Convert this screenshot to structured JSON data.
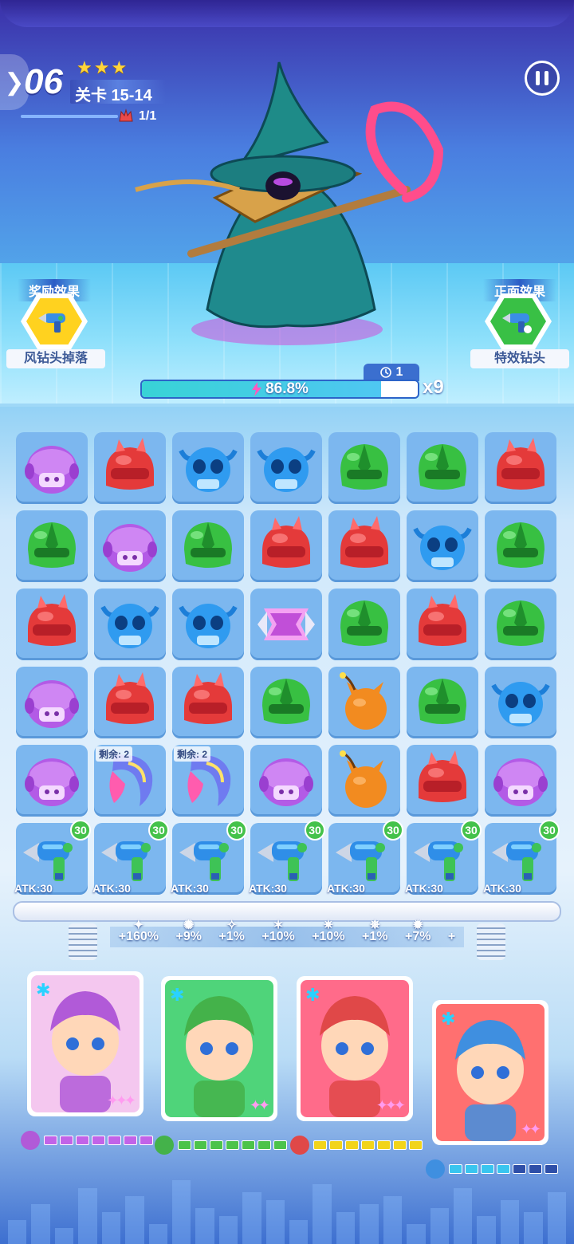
{
  "header": {
    "wave_number": "06",
    "stars": "★★★",
    "stage_label": "关卡 15-14",
    "kill_progress": "1/1",
    "kill_progress_fraction": 1.0,
    "pause_icon": "pause-icon"
  },
  "boss": {
    "name_icon": "witch-boss"
  },
  "reward_effect": {
    "title": "奖励效果",
    "caption": "风钻头掉落",
    "icon": "drill-gun-icon",
    "hex_color": "#ffd21f"
  },
  "positive_effect": {
    "title": "正面效果",
    "caption": "特效钻头",
    "icon": "drill-gun-icon",
    "hex_color": "#39c045"
  },
  "energy": {
    "timer": "1",
    "percent_text": "86.8%",
    "percent": 86.8,
    "multiplier": "x9"
  },
  "board": {
    "rows": [
      [
        "purple",
        "red",
        "blue",
        "blue",
        "green",
        "green",
        "red"
      ],
      [
        "green",
        "purple",
        "green",
        "red",
        "red",
        "blue",
        "green"
      ],
      [
        "red",
        "blue",
        "blue",
        "crystal",
        "green",
        "red",
        "green"
      ],
      [
        "purple",
        "red",
        "red",
        "green",
        "bomb",
        "green",
        "blue"
      ],
      [
        "purple",
        "boomerang",
        "boomerang",
        "purple",
        "bomb",
        "red",
        "purple"
      ]
    ],
    "remain_label": "剩余: 2",
    "weapons": [
      {
        "atk": "ATK:30",
        "badge": "30"
      },
      {
        "atk": "ATK:30",
        "badge": "30"
      },
      {
        "atk": "ATK:30",
        "badge": "30"
      },
      {
        "atk": "ATK:30",
        "badge": "30"
      },
      {
        "atk": "ATK:30",
        "badge": "30"
      },
      {
        "atk": "ATK:30",
        "badge": "30"
      },
      {
        "atk": "ATK:30",
        "badge": "30"
      }
    ]
  },
  "buffs": [
    "+160%",
    "+9%",
    "+1%",
    "+10%",
    "+10%",
    "+1%",
    "+7%",
    "+"
  ],
  "heroes": [
    {
      "name": "hero-headphone-girl",
      "bg": "#f4c7ef",
      "rank": "✦✦✦",
      "energy_color": "#c263e8",
      "energy_filled": 7,
      "energy_total": 7,
      "icon_color": "#b15ad8"
    },
    {
      "name": "hero-blue-knight",
      "bg": "#4fd47a",
      "rank": "✦✦",
      "energy_color": "#4cc34a",
      "energy_filled": 7,
      "energy_total": 7,
      "icon_color": "#44b24a"
    },
    {
      "name": "hero-robot-rabbit",
      "bg": "#ff6b8a",
      "rank": "✦✦✦",
      "energy_color": "#f2d41a",
      "energy_filled": 7,
      "energy_total": 7,
      "icon_color": "#e04848"
    },
    {
      "name": "hero-skull-warrior",
      "bg": "#ff7070",
      "rank": "✦✦",
      "energy_color": "#39c5ef",
      "energy_filled": 4,
      "energy_total": 7,
      "icon_color": "#3f8fe0"
    }
  ]
}
